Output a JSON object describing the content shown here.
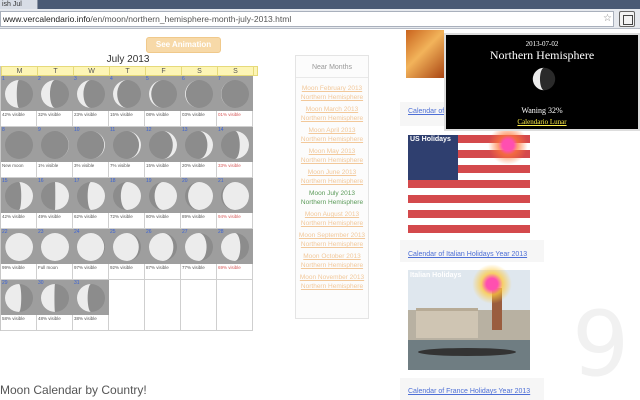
{
  "browser": {
    "tab_title": "ish Jul",
    "url_host": "www.vercalendario.info",
    "url_path": "/en/moon/northern_hemisphere-month-july-2013.html"
  },
  "page": {
    "animation_button": "See Animation",
    "calendar_title": "July 2013",
    "weekdays": [
      "M",
      "T",
      "W",
      "T",
      "F",
      "S",
      "S"
    ],
    "near_months_title": "Near Months",
    "near_months": [
      "Moon February 2013 Northern Hemisphere",
      "Moon March 2013 Northern Hemisphere",
      "Moon April 2013 Northern Hemisphere",
      "Moon May 2013 Northern Hemisphere",
      "Moon June 2013 Northern Hemisphere",
      "Moon July 2013 Northern Hemisphere",
      "Moon August 2013 Northern Hemisphere",
      "Moon September 2013 Northern Hemisphere",
      "Moon October 2013 Northern Hemisphere",
      "Moon November 2013 Northern Hemisphere"
    ],
    "current_month_index": 5,
    "footer_heading": "Moon Calendar by Country!",
    "sidebar": {
      "link_top": "Calendar of",
      "us_label": "US Holidays",
      "italian_link": "Calendar of Italian Holidays Year 2013",
      "italian_label": "Italian Holidays",
      "france_link": "Calendar of France Holidays Year 2013"
    },
    "background_digit": "9"
  },
  "calendar_weeks": [
    [
      {
        "date": "1",
        "vis": "42% visible",
        "lit": 0.42,
        "side": "left"
      },
      {
        "date": "2",
        "vis": "32% visible",
        "lit": 0.32,
        "side": "left"
      },
      {
        "date": "3",
        "vis": "23% visible",
        "lit": 0.23,
        "side": "left"
      },
      {
        "date": "4",
        "vis": "15% visible",
        "lit": 0.15,
        "side": "left"
      },
      {
        "date": "5",
        "vis": "08% visible",
        "lit": 0.08,
        "side": "left"
      },
      {
        "date": "6",
        "vis": "03% visible",
        "lit": 0.03,
        "side": "left"
      },
      {
        "date": "7",
        "vis": "01% visible",
        "lit": 0.01,
        "side": "left",
        "red": true
      }
    ],
    [
      {
        "date": "8",
        "vis": "New moon",
        "lit": 0.0,
        "side": "right"
      },
      {
        "date": "9",
        "vis": "1% visible",
        "lit": 0.01,
        "side": "right"
      },
      {
        "date": "10",
        "vis": "3% visible",
        "lit": 0.03,
        "side": "right"
      },
      {
        "date": "11",
        "vis": "7% visible",
        "lit": 0.07,
        "side": "right"
      },
      {
        "date": "12",
        "vis": "15% visible",
        "lit": 0.15,
        "side": "right"
      },
      {
        "date": "13",
        "vis": "20% visible",
        "lit": 0.2,
        "side": "right"
      },
      {
        "date": "14",
        "vis": "33% visible",
        "lit": 0.33,
        "side": "right",
        "red": true
      }
    ],
    [
      {
        "date": "15",
        "vis": "42% visible",
        "lit": 0.42,
        "side": "right"
      },
      {
        "date": "16",
        "vis": "49% visible",
        "lit": 0.49,
        "side": "right"
      },
      {
        "date": "17",
        "vis": "62% visible",
        "lit": 0.62,
        "side": "right"
      },
      {
        "date": "18",
        "vis": "72% visible",
        "lit": 0.72,
        "side": "right"
      },
      {
        "date": "19",
        "vis": "80% visible",
        "lit": 0.8,
        "side": "right"
      },
      {
        "date": "20",
        "vis": "89% visible",
        "lit": 0.89,
        "side": "right"
      },
      {
        "date": "21",
        "vis": "94% visible",
        "lit": 0.94,
        "side": "right",
        "red": true
      }
    ],
    [
      {
        "date": "22",
        "vis": "99% visible",
        "lit": 0.99,
        "side": "right"
      },
      {
        "date": "23",
        "vis": "Full moon",
        "lit": 1.0,
        "side": "right"
      },
      {
        "date": "24",
        "vis": "97% visible",
        "lit": 0.97,
        "side": "left"
      },
      {
        "date": "25",
        "vis": "92% visible",
        "lit": 0.92,
        "side": "left"
      },
      {
        "date": "26",
        "vis": "87% visible",
        "lit": 0.87,
        "side": "left"
      },
      {
        "date": "27",
        "vis": "77% visible",
        "lit": 0.77,
        "side": "left"
      },
      {
        "date": "28",
        "vis": "69% visible",
        "lit": 0.69,
        "side": "left",
        "red": true
      }
    ],
    [
      {
        "date": "29",
        "vis": "58% visible",
        "lit": 0.58,
        "side": "left"
      },
      {
        "date": "30",
        "vis": "48% visible",
        "lit": 0.48,
        "side": "left"
      },
      {
        "date": "31",
        "vis": "38% visible",
        "lit": 0.38,
        "side": "left"
      },
      {
        "empty": true
      },
      {
        "empty": true
      },
      {
        "empty": true
      },
      {
        "empty": true
      }
    ]
  ],
  "popup": {
    "date": "2013-07-02",
    "title": "Northern Hemisphere",
    "phase": "Waning 32%",
    "lit": 0.32,
    "link": "Calendario Lunar"
  }
}
